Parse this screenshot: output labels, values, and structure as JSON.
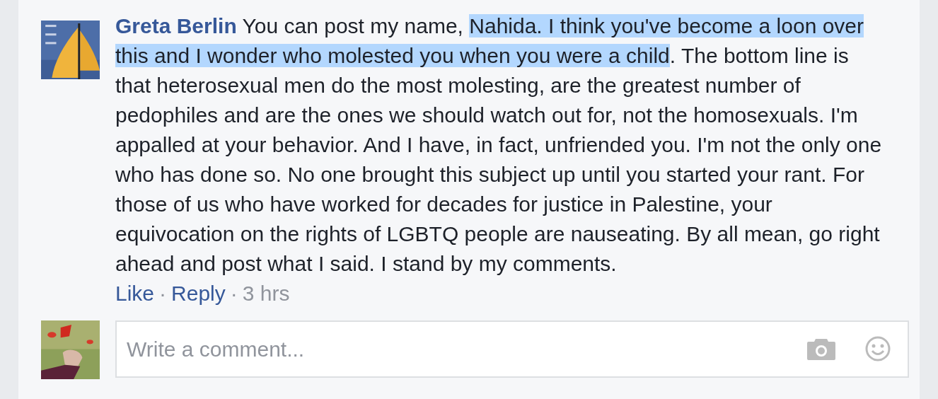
{
  "comment": {
    "author": "Greta Berlin",
    "segments": [
      {
        "text": "You can post my name, ",
        "highlighted": false
      },
      {
        "text": "Nahida. I think you've become a loon over this and I wonder who molested you when you were a child",
        "highlighted": true
      },
      {
        "text": ". The bottom line is that heterosexual men do the most molesting, are the greatest number of pedophiles and are the ones we should watch out for, not the homosexuals. I'm appalled at your behavior. And I have, in fact, unfriended you. I'm not the only one who has done so. No one brought this subject up until you started your rant. For those of us who have worked for decades for justice in Palestine, your equivocation on the rights of LGBTQ people are nauseating. By all mean, go right ahead and post what I said. I stand by my comments.",
        "highlighted": false
      }
    ],
    "actions": [
      {
        "kind": "link",
        "text": "Like"
      },
      {
        "kind": "separator",
        "text": "·"
      },
      {
        "kind": "link",
        "text": "Reply"
      },
      {
        "kind": "separator",
        "text": "·"
      },
      {
        "kind": "time",
        "text": "3 hrs"
      }
    ]
  },
  "composer": {
    "placeholder": "Write a comment..."
  }
}
